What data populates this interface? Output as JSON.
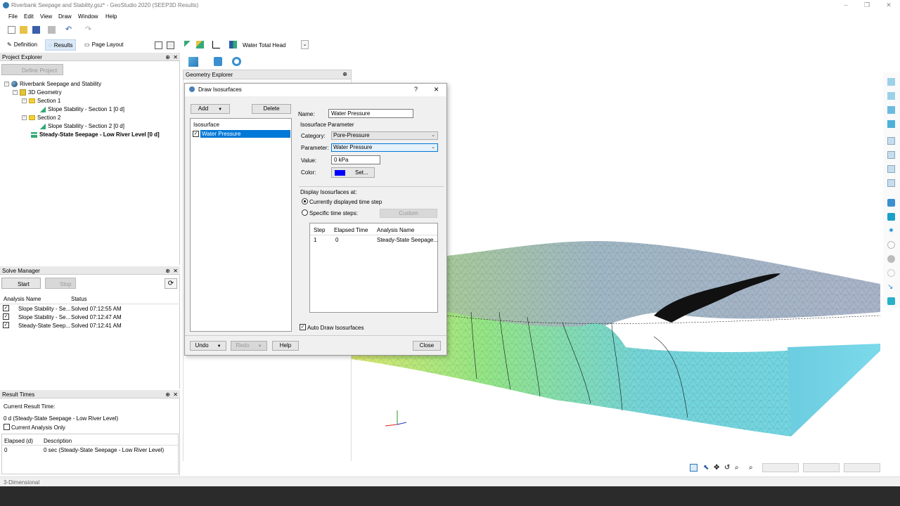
{
  "window": {
    "title": "Riverbank Seepage and Stability.gsz* - GeoStudio 2020 (SEEP3D Results)"
  },
  "menu": [
    "File",
    "Edit",
    "View",
    "Draw",
    "Window",
    "Help"
  ],
  "modes": {
    "definition": "Definition",
    "results": "Results",
    "page_layout": "Page Layout",
    "result_variable": "Water Total Head"
  },
  "project_explorer": {
    "title": "Project Explorer",
    "define_project": "Define Project",
    "tree": {
      "root": "Riverbank Seepage and Stability",
      "geometry": "3D Geometry",
      "section1": "Section 1",
      "section1_analysis": "Slope Stability - Section 1 [0 d]",
      "section2": "Section 2",
      "section2_analysis": "Slope Stability - Section 2 [0 d]",
      "seepage": "Steady-State Seepage - Low River Level [0 d]"
    }
  },
  "solve_manager": {
    "title": "Solve Manager",
    "start": "Start",
    "stop": "Stop",
    "columns": [
      "Analysis Name",
      "Status"
    ],
    "rows": [
      {
        "name": "Slope Stability - Se...",
        "status": "Solved 07:12:55 AM"
      },
      {
        "name": "Slope Stability - Se...",
        "status": "Solved 07:12:47 AM"
      },
      {
        "name": "Steady-State Seep...",
        "status": "Solved 07:12:41 AM"
      }
    ]
  },
  "result_times": {
    "title": "Result Times",
    "current_label": "Current Result Time:",
    "current_value": "0 d (Steady-State Seepage - Low River Level)",
    "current_only": "Current Analysis Only",
    "columns": [
      "Elapsed (d)",
      "Description"
    ],
    "rows": [
      {
        "elapsed": "0",
        "description": "0 sec (Steady-State Seepage - Low River Level)"
      }
    ]
  },
  "geometry_explorer": {
    "title": "Geometry Explorer"
  },
  "dialog": {
    "title": "Draw Isosurfaces",
    "help_glyph": "?",
    "close_glyph": "×",
    "add": "Add",
    "delete": "Delete",
    "list_header": "Isosurface",
    "list_item": "Water Pressure",
    "name_label": "Name:",
    "name_value": "Water Pressure",
    "param_group": "Isosurface Parameter",
    "category_label": "Category:",
    "category_value": "Pore-Pressure",
    "parameter_label": "Parameter:",
    "parameter_value": "Water Pressure",
    "value_label": "Value:",
    "value_value": "0 kPa",
    "color_label": "Color:",
    "color_hex": "#0000ff",
    "set": "Set...",
    "display_label": "Display Isosurfaces at:",
    "opt_current": "Currently displayed time step",
    "opt_specific": "Specific time steps:",
    "custom": "Custom",
    "step_columns": [
      "Step",
      "Elapsed Time",
      "Analysis Name"
    ],
    "step_rows": [
      {
        "step": "1",
        "elapsed": "0",
        "analysis": "Steady-State Seepage..."
      }
    ],
    "auto_draw": "Auto Draw Isosurfaces",
    "undo": "Undo",
    "redo": "Redo",
    "help": "Help",
    "close": "Close"
  },
  "status": {
    "mode": "3-Dimensional"
  },
  "colors": {
    "accent": "#0078d7",
    "selection": "#0078d7",
    "panel": "#f0f0f0"
  }
}
